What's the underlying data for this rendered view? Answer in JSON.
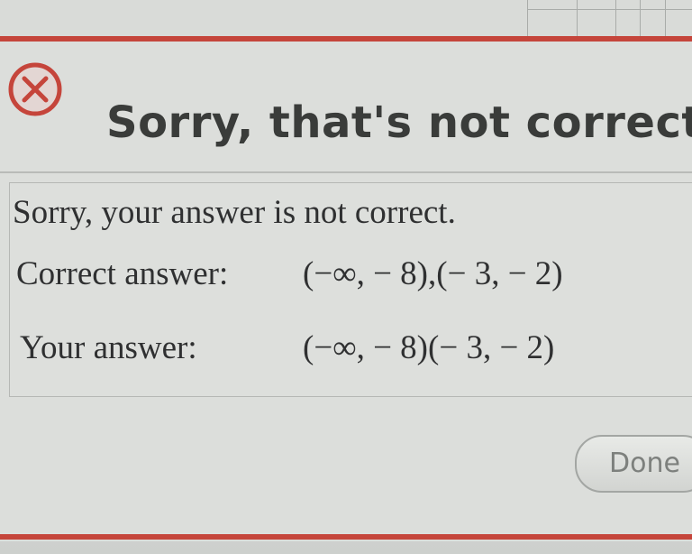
{
  "dialog": {
    "title": "Sorry, that's not correct.",
    "icon": "error-x-circle-icon",
    "accent_color": "#c5453b"
  },
  "feedback": {
    "message": "Sorry, your answer is not correct.",
    "correct_label": "Correct answer:",
    "correct_value": "(−∞, − 8),(− 3, − 2)",
    "your_label": "Your answer:",
    "your_value": "(−∞, − 8)(− 3, − 2)"
  },
  "buttons": {
    "done_label": "Done"
  }
}
